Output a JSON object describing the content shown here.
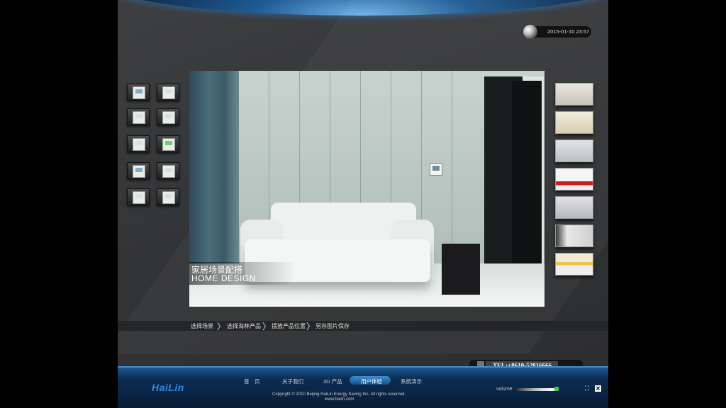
{
  "datetime": "2015-01-10 23:57",
  "scene": {
    "title_cn": "家居场景配搭",
    "title_en": "HOME DESIGN"
  },
  "breadcrumb": {
    "steps": [
      "选择场景",
      "选择海林产品",
      "摆放产品位置",
      "另存图片保存"
    ],
    "separator": "〉"
  },
  "nav": {
    "items": [
      "首　页",
      "关于我们",
      "3D 产品",
      "用户体验",
      "系统演示"
    ],
    "active_index": 3
  },
  "footer": {
    "logo": "HaiLin",
    "copyright": "Copyright © 2010 Beijing HaiLin Energy Saving Inc. All rights reserved.",
    "url": "www.hailin.com",
    "tel": "TEL:+8610-52816666",
    "volume_label": "volume",
    "volume_level": 0.9
  },
  "colors": {
    "accent": "#1d5d9a",
    "nav_active": "#3d8fd4",
    "volume_indicator": "#3ad33a"
  },
  "icons": {
    "clock": "moon-icon",
    "fullscreen": "fullscreen-icon",
    "close": "close-icon"
  }
}
